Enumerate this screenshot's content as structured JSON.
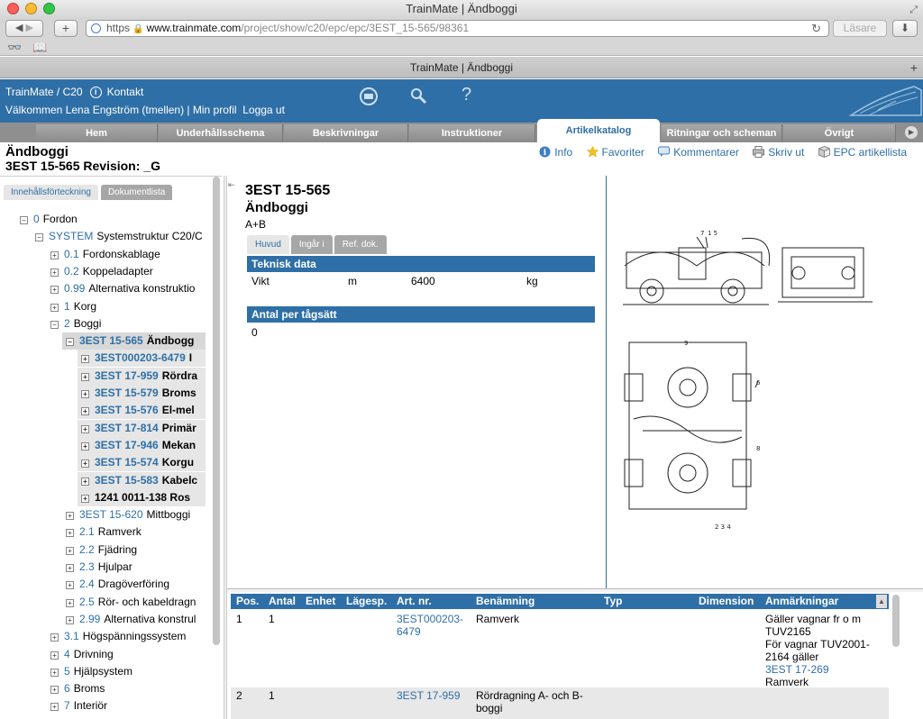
{
  "browser": {
    "window_title": "TrainMate | Ändboggi",
    "tab_title": "TrainMate | Ändboggi",
    "url_scheme": "https",
    "url_host": "www.trainmate.com",
    "url_path": "/project/show/c20/epc/epc/3EST_15-565/98361",
    "reader_label": "Läsare"
  },
  "app": {
    "brand": "TrainMate / C20",
    "contact": "Kontakt",
    "welcome": "Välkommen Lena Engström (tmellen) | Min profil",
    "logout": "Logga ut",
    "help": "?"
  },
  "nav": {
    "tabs": [
      "Hem",
      "Underhållsschema",
      "Beskrivningar",
      "Instruktioner",
      "Artikelkatalog",
      "Ritningar och scheman",
      "Övrigt"
    ],
    "active": "Artikelkatalog"
  },
  "page": {
    "title": "Ändboggi",
    "subtitle": "3EST 15-565 Revision: _G"
  },
  "actions": {
    "info": "Info",
    "favorites": "Favoriter",
    "comments": "Kommentarer",
    "print": "Skriv ut",
    "epc_list": "EPC artikellista"
  },
  "left": {
    "tab_toc": "Innehållsförteckning",
    "tab_docs": "Dokumentlista",
    "tree": [
      {
        "code": "0",
        "label": "Fordon",
        "level": 0,
        "sign": "−"
      },
      {
        "code": "SYSTEM",
        "label": "Systemstruktur C20/C",
        "level": 1,
        "sign": "−"
      },
      {
        "code": "0.1",
        "label": "Fordonskablage",
        "level": 2,
        "sign": "+"
      },
      {
        "code": "0.2",
        "label": "Koppeladapter",
        "level": 2,
        "sign": "+"
      },
      {
        "code": "0.99",
        "label": "Alternativa konstruktio",
        "level": 2,
        "sign": "+"
      },
      {
        "code": "1",
        "label": "Korg",
        "level": 2,
        "sign": "+"
      },
      {
        "code": "2",
        "label": "Boggi",
        "level": 2,
        "sign": "−"
      },
      {
        "code": "3EST 15-565",
        "label": "Ändbogg",
        "level": 3,
        "sign": "−",
        "bold": true,
        "sel": true
      },
      {
        "code": "3EST000203-6479",
        "label": "I",
        "level": 4,
        "sign": "+",
        "bold": true,
        "sub": true
      },
      {
        "code": "3EST 17-959",
        "label": "Rördra",
        "level": 4,
        "sign": "+",
        "bold": true,
        "sub": true
      },
      {
        "code": "3EST 15-579",
        "label": "Broms",
        "level": 4,
        "sign": "+",
        "bold": true,
        "sub": true
      },
      {
        "code": "3EST 15-576",
        "label": "El-mel",
        "level": 4,
        "sign": "+",
        "bold": true,
        "sub": true
      },
      {
        "code": "3EST 17-814",
        "label": "Primär",
        "level": 4,
        "sign": "+",
        "bold": true,
        "sub": true
      },
      {
        "code": "3EST 17-946",
        "label": "Mekan",
        "level": 4,
        "sign": "+",
        "bold": true,
        "sub": true
      },
      {
        "code": "3EST 15-574",
        "label": "Korgu",
        "level": 4,
        "sign": "+",
        "bold": true,
        "sub": true
      },
      {
        "code": "3EST 15-583",
        "label": "Kabelc",
        "level": 4,
        "sign": "+",
        "bold": true,
        "sub": true
      },
      {
        "code": "",
        "label": "1241 0011-138 Ros",
        "level": 4,
        "sign": "+",
        "bold": true,
        "sub": true
      },
      {
        "code": "3EST 15-620",
        "label": "Mittboggi",
        "level": 3,
        "sign": "+"
      },
      {
        "code": "2.1",
        "label": "Ramverk",
        "level": 3,
        "sign": "+"
      },
      {
        "code": "2.2",
        "label": "Fjädring",
        "level": 3,
        "sign": "+"
      },
      {
        "code": "2.3",
        "label": "Hjulpar",
        "level": 3,
        "sign": "+"
      },
      {
        "code": "2.4",
        "label": "Dragöverföring",
        "level": 3,
        "sign": "+"
      },
      {
        "code": "2.5",
        "label": "Rör- och kabeldragn",
        "level": 3,
        "sign": "+"
      },
      {
        "code": "2.99",
        "label": "Alternativa konstrul",
        "level": 3,
        "sign": "+"
      },
      {
        "code": "3.1",
        "label": "Högspänningssystem",
        "level": 2,
        "sign": "+"
      },
      {
        "code": "4",
        "label": "Drivning",
        "level": 2,
        "sign": "+"
      },
      {
        "code": "5",
        "label": "Hjälpsystem",
        "level": 2,
        "sign": "+"
      },
      {
        "code": "6",
        "label": "Broms",
        "level": 2,
        "sign": "+"
      },
      {
        "code": "7",
        "label": "Interiör",
        "level": 2,
        "sign": "+"
      }
    ]
  },
  "detail": {
    "code": "3EST 15-565",
    "name": "Ändboggi",
    "variant": "A+B",
    "tabs": [
      "Huvud",
      "Ingår i",
      "Ref. dok."
    ],
    "active_tab": "Huvud",
    "tech_header": "Teknisk data",
    "tech_row": {
      "name": "Vikt",
      "unit_sym": "m",
      "value": "6400",
      "unit": "kg"
    },
    "qty_header": "Antal per tågsätt",
    "qty_value": "0"
  },
  "parts_table": {
    "columns": [
      "Pos.",
      "Antal",
      "Enhet",
      "Lägesp.",
      "Art. nr.",
      "Benämning",
      "Typ",
      "Dimension",
      "Anmärkningar"
    ],
    "rows": [
      {
        "pos": "1",
        "antal": "1",
        "art_line1": "3EST000203-",
        "art_line2": "6479",
        "benamning_line1": "Ramverk",
        "benamning_line2": "",
        "anm_line1": "Gäller vagnar fr o m",
        "anm_line2": "TUV2165",
        "anm_line3": "För vagnar TUV2001-",
        "anm_line4": "2164 gäller",
        "anm_link": "3EST 17-269",
        "anm_line6": "Ramverk"
      },
      {
        "pos": "2",
        "antal": "1",
        "art_line1": "3EST 17-959",
        "art_line2": "",
        "benamning_line1": "Rördragning A- och B-",
        "benamning_line2": "boggi",
        "anm_line1": "",
        "anm_line2": "",
        "anm_line3": "",
        "anm_line4": "",
        "anm_link": "",
        "anm_line6": ""
      }
    ]
  },
  "colors": {
    "accent": "#2f6fa7",
    "nav_gray": "#8f8f8f"
  }
}
